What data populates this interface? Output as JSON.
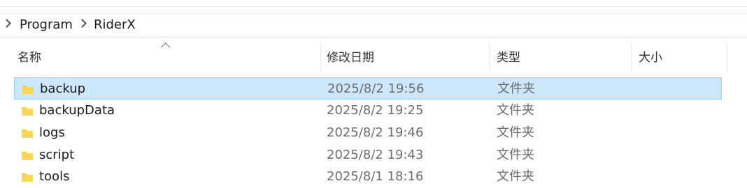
{
  "breadcrumb": {
    "items": [
      "Program",
      "RiderX"
    ]
  },
  "columns": {
    "name": "名称",
    "modified": "修改日期",
    "type": "类型",
    "size": "大小"
  },
  "files": [
    {
      "name": "backup",
      "modified": "2025/8/2 19:56",
      "type": "文件夹",
      "selected": true
    },
    {
      "name": "backupData",
      "modified": "2025/8/2 19:25",
      "type": "文件夹",
      "selected": false
    },
    {
      "name": "logs",
      "modified": "2025/8/2 19:46",
      "type": "文件夹",
      "selected": false
    },
    {
      "name": "script",
      "modified": "2025/8/2 19:43",
      "type": "文件夹",
      "selected": false
    },
    {
      "name": "tools",
      "modified": "2025/8/1 18:16",
      "type": "文件夹",
      "selected": false
    }
  ],
  "colors": {
    "selection": "#cce8ff",
    "selection_border": "#99d1ff",
    "folder": "#ffc83d"
  },
  "icons": {
    "folder": "folder-icon",
    "chevron": "chevron-right-icon",
    "sort": "sort-ascending-icon"
  }
}
